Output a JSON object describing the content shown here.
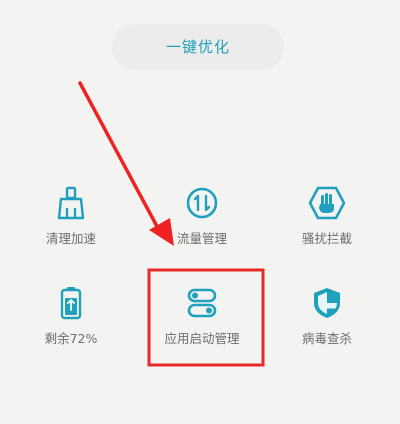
{
  "top_action": {
    "label": "一键优化"
  },
  "tools": [
    {
      "label": "清理加速",
      "icon": "broom-icon"
    },
    {
      "label": "流量管理",
      "icon": "data-usage-icon"
    },
    {
      "label": "骚扰拦截",
      "icon": "hand-block-icon"
    },
    {
      "label": "剩余72%",
      "icon": "battery-icon"
    },
    {
      "label": "应用启动管理",
      "icon": "app-launch-toggle-icon"
    },
    {
      "label": "病毒查杀",
      "icon": "shield-icon"
    }
  ],
  "annotations": {
    "arrow_color": "#ee2222",
    "highlight_color": "#e52a2a"
  },
  "colors": {
    "accent": "#1fa0bd",
    "background": "#f3f3f1",
    "label_text": "#6d6d6d"
  }
}
